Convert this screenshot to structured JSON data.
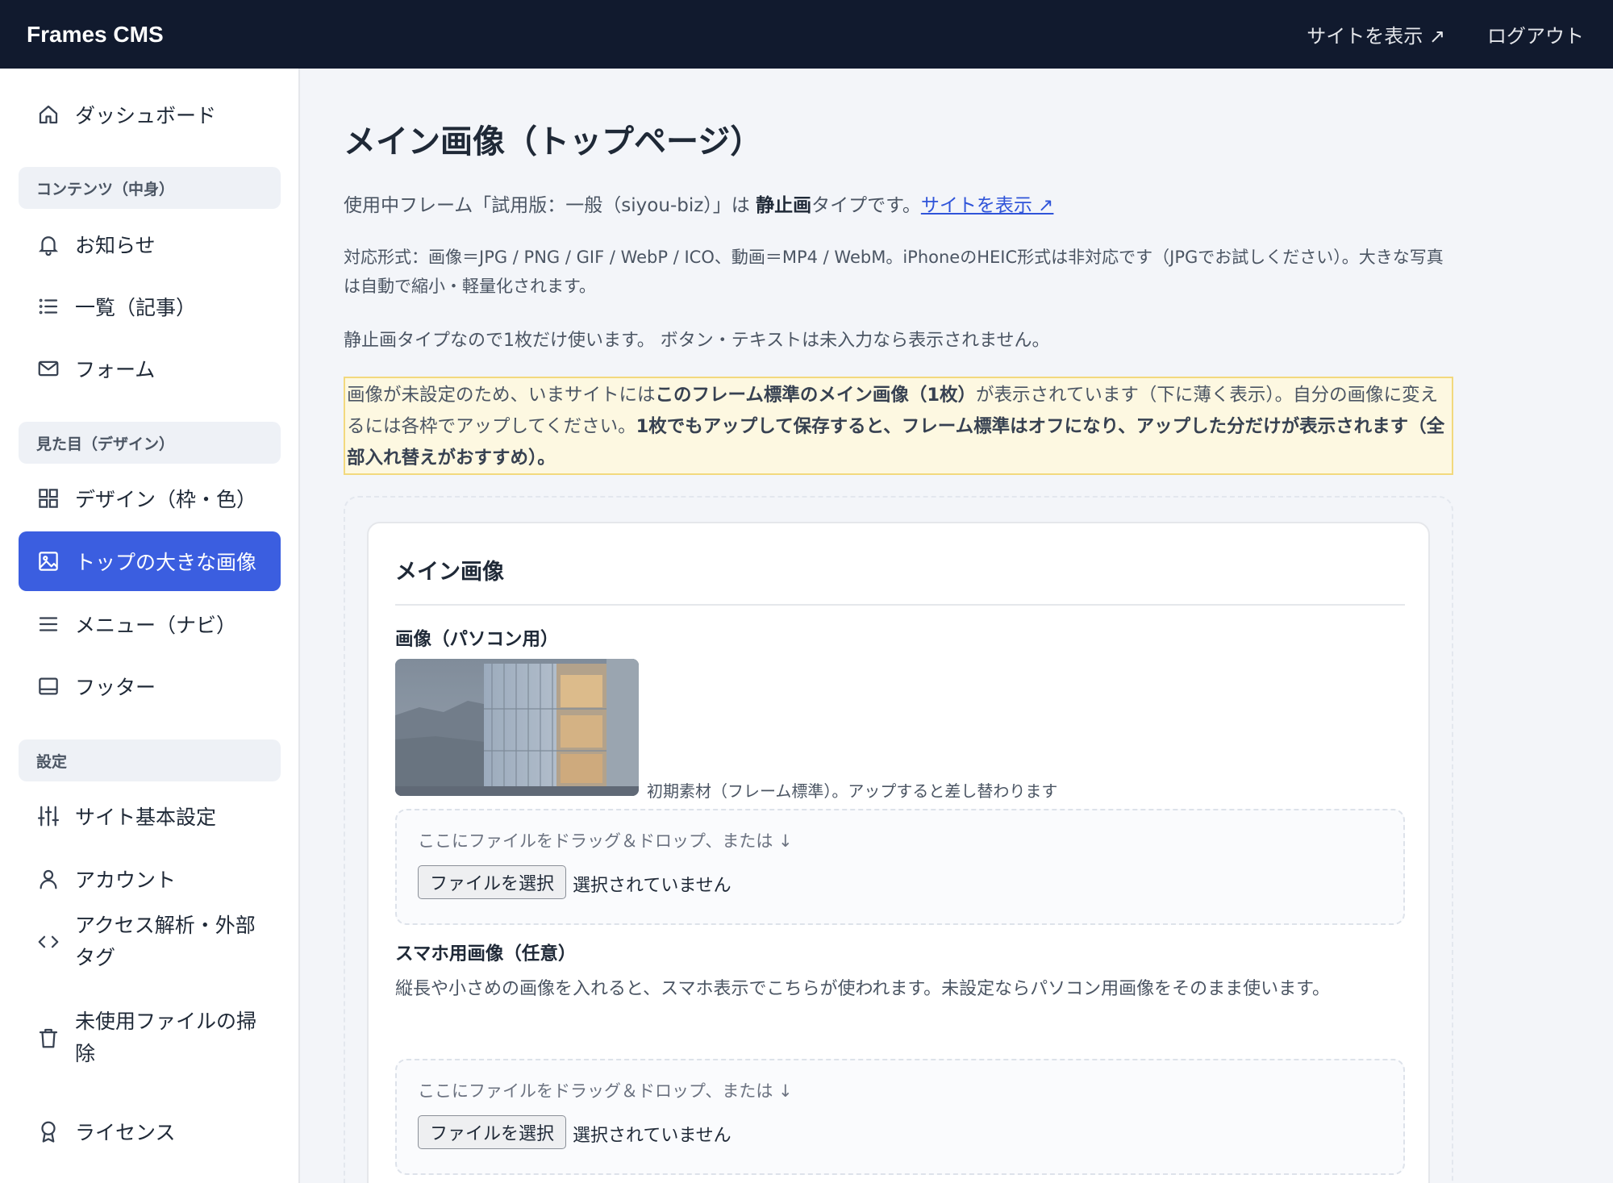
{
  "topbar": {
    "brand": "Frames CMS",
    "view_site": "サイトを表示 ↗",
    "logout": "ログアウト"
  },
  "sidebar": {
    "dashboard": {
      "label": "ダッシュボード",
      "icon": "home-icon"
    },
    "sections": [
      {
        "title": "コンテンツ（中身）"
      },
      {
        "title": "見た目（デザイン）"
      },
      {
        "title": "設定"
      }
    ],
    "items": [
      {
        "label": "お知らせ",
        "icon": "bell-icon"
      },
      {
        "label": "一覧（記事）",
        "icon": "list-icon"
      },
      {
        "label": "フォーム",
        "icon": "mail-icon"
      },
      {
        "label": "デザイン（枠・色）",
        "icon": "grid-icon"
      },
      {
        "label": "トップの大きな画像",
        "icon": "image-icon",
        "active": true
      },
      {
        "label": "メニュー（ナビ）",
        "icon": "menu-icon"
      },
      {
        "label": "フッター",
        "icon": "footer-icon"
      },
      {
        "label": "サイト基本設定",
        "icon": "sliders-icon"
      },
      {
        "label": "アカウント",
        "icon": "user-icon"
      },
      {
        "label": "アクセス解析・外部タグ",
        "icon": "code-icon"
      },
      {
        "label": "未使用ファイルの掃除",
        "icon": "trash-icon"
      },
      {
        "label": "ライセンス",
        "icon": "award-icon"
      }
    ]
  },
  "main": {
    "title": "メイン画像（トップページ）",
    "intro": {
      "prefix": "使用中フレーム「試用版：一般（siyou-biz）」は ",
      "bold": "静止画",
      "suffix": "タイプです。",
      "link": "サイトを表示 ↗"
    },
    "formats": "対応形式：画像＝JPG / PNG / GIF / WebP / ICO、動画＝MP4 / WebM。iPhoneのHEIC形式は非対応です（JPGでお試しください）。大きな写真は自動で縮小・軽量化されます。",
    "usage": "静止画タイプなので1枚だけ使います。 ボタン・テキストは未入力なら表示されません。",
    "notice": {
      "t1": "画像が未設定のため、いまサイトには",
      "b1": "このフレーム標準のメイン画像（1枚）",
      "t2": "が表示されています（下に薄く表示）。自分の画像に変えるには各枠でアップしてください。",
      "b2": "1枚でもアップして保存すると、フレーム標準はオフになり、アップした分だけが表示されます（全部入れ替えがおすすめ）。"
    },
    "card": {
      "title": "メイン画像",
      "pc_label": "画像（パソコン用）",
      "thumb_caption": "初期素材（フレーム標準）。アップすると差し替わります",
      "dropzone_hint": "ここにファイルをドラッグ＆ドロップ、または ↓",
      "file_button": "ファイルを選択",
      "file_status": "選択されていません",
      "sp_label": "スマホ用画像（任意）",
      "sp_desc": "縦長や小さめの画像を入れると、スマホ表示でこちらが使われます。未設定ならパソコン用画像をそのまま使います。"
    }
  },
  "colors": {
    "topbar": "#111a2e",
    "accent": "#3b5ee0",
    "notice_bg": "#fdf8e1",
    "notice_border": "#f2d97e"
  }
}
